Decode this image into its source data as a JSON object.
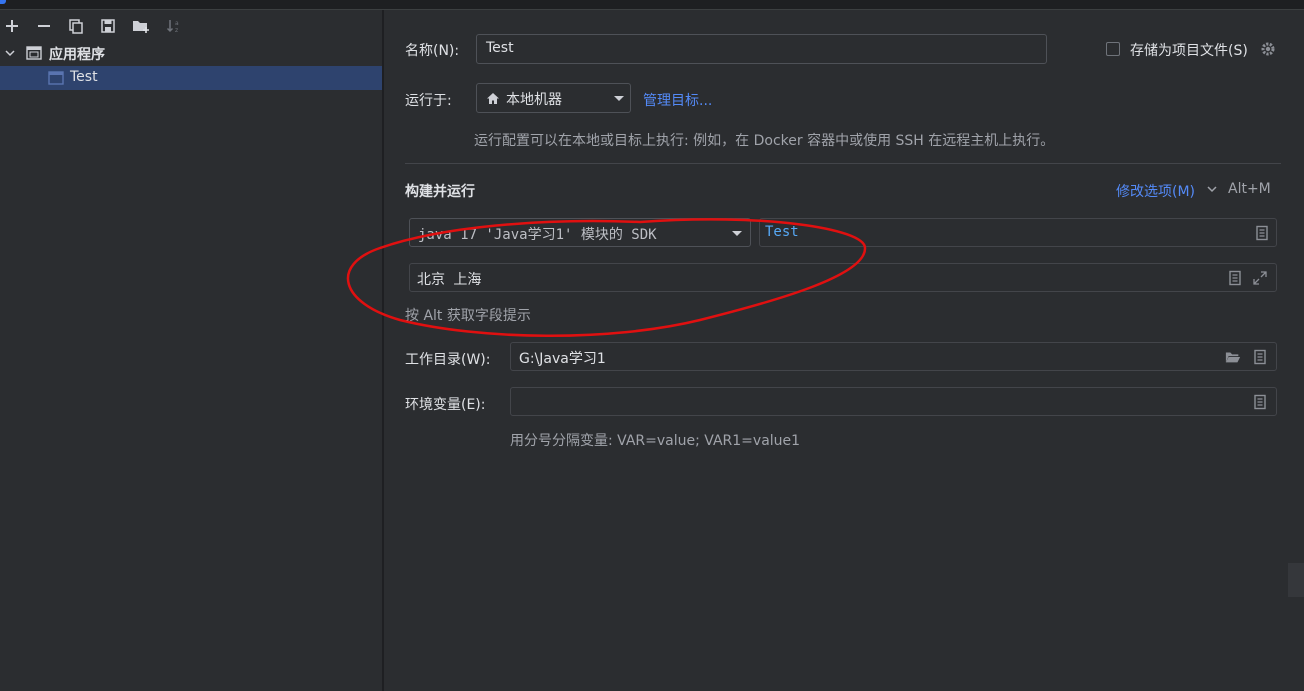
{
  "left_panel": {
    "toolbar": {
      "add_icon": "plus-icon",
      "remove_icon": "minus-icon",
      "copy_icon": "copy-icon",
      "save_icon": "save-icon",
      "new_folder_icon": "new-folder-icon",
      "sort_icon": "sort-icon"
    },
    "tree": {
      "group_label": "应用程序",
      "item_label": "Test"
    }
  },
  "form": {
    "name_label": "名称(N):",
    "name_value": "Test",
    "store_label": "存储为项目文件(S)",
    "run_on_label": "运行于:",
    "run_on_value": "本地机器",
    "manage_targets_link": "管理目标...",
    "run_on_hint": "运行配置可以在本地或目标上执行: 例如，在 Docker 容器中或使用 SSH 在远程主机上执行。",
    "section_title": "构建并运行",
    "modify_options_link": "修改选项(M)",
    "modify_options_shortcut": "Alt+M",
    "sdk_value": "java 17 'Java学习1' 模块的 SDK",
    "main_class_value": "Test",
    "program_args_value": "北京 上海",
    "alt_hint": "按 Alt 获取字段提示",
    "working_dir_label": "工作目录(W):",
    "working_dir_value": "G:\\Java学习1",
    "env_label": "环境变量(E):",
    "env_value": "",
    "env_hint": "用分号分隔变量: VAR=value; VAR1=value1"
  },
  "colors": {
    "background": "#2b2d30",
    "selection": "#2e436e",
    "link": "#548af7",
    "annotation": "#e01010"
  }
}
